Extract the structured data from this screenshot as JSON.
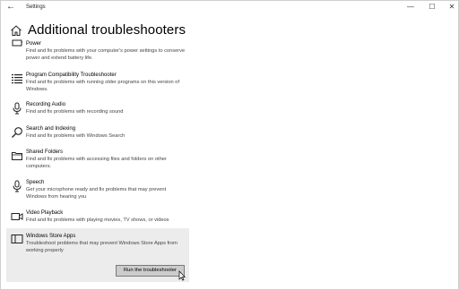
{
  "window": {
    "app_title": "Settings",
    "back_glyph": "←",
    "minimize_glyph": "—",
    "maximize_glyph": "☐",
    "close_glyph": "✕"
  },
  "header": {
    "title": "Additional troubleshooters"
  },
  "items": [
    {
      "name": "Power",
      "desc": "Find and fix problems with your computer's power settings to conserve power and extend battery life.",
      "icon": "power-icon"
    },
    {
      "name": "Program Compatibility Troubleshooter",
      "desc": "Find and fix problems with running older programs on this version of Windows.",
      "icon": "list-icon"
    },
    {
      "name": "Recording Audio",
      "desc": "Find and fix problems with recording sound",
      "icon": "microphone-icon"
    },
    {
      "name": "Search and Indexing",
      "desc": "Find and fix problems with Windows Search",
      "icon": "search-icon"
    },
    {
      "name": "Shared Folders",
      "desc": "Find and fix problems with accessing files and folders on other computers.",
      "icon": "shared-folder-icon"
    },
    {
      "name": "Speech",
      "desc": "Get your microphone ready and fix problems that may prevent Windows from hearing you",
      "icon": "microphone-icon"
    },
    {
      "name": "Video Playback",
      "desc": "Find and fix problems with playing movies, TV shows, or videos",
      "icon": "video-icon"
    },
    {
      "name": "Windows Store Apps",
      "desc": "Troubleshoot problems that may prevent Windows Store Apps from working properly",
      "icon": "store-apps-icon"
    }
  ],
  "run_button": {
    "label": "Run the troubleshooter"
  }
}
